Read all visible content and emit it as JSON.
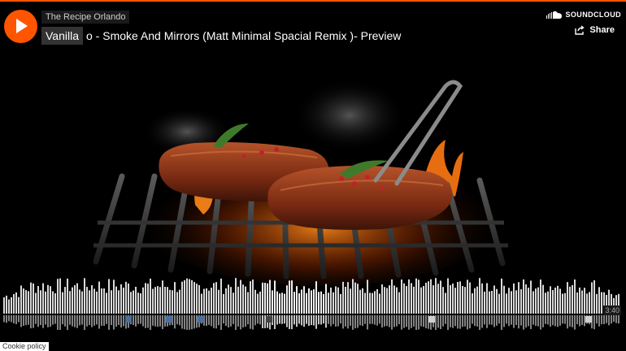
{
  "player": {
    "uploader": "The Recipe Orlando",
    "title_chip": "Vanilla",
    "title_rest": "o - Smoke And Mirrors  (Matt Minimal Spacial Remix )- Preview",
    "duration": "3:40"
  },
  "brand": {
    "label": "SOUNDCLOUD"
  },
  "actions": {
    "share_label": "Share"
  },
  "footer": {
    "cookie_label": "Cookie policy"
  },
  "artwork": {
    "description_icon": "grilled-steaks-artwork"
  },
  "waveform": {
    "played_fraction": 0.0,
    "highlight_fraction_start": 0.415,
    "highlight_fraction_end": 0.52
  },
  "comments": [
    {
      "position_fraction": 0.2,
      "tone": "blue"
    },
    {
      "position_fraction": 0.265,
      "tone": "blue"
    },
    {
      "position_fraction": 0.315,
      "tone": "blue"
    },
    {
      "position_fraction": 0.425,
      "tone": "dark"
    },
    {
      "position_fraction": 0.685,
      "tone": "light"
    },
    {
      "position_fraction": 0.935,
      "tone": "light"
    }
  ],
  "colors": {
    "accent": "#ff5500",
    "waveform": "#d9d9d9",
    "background": "#000000"
  }
}
